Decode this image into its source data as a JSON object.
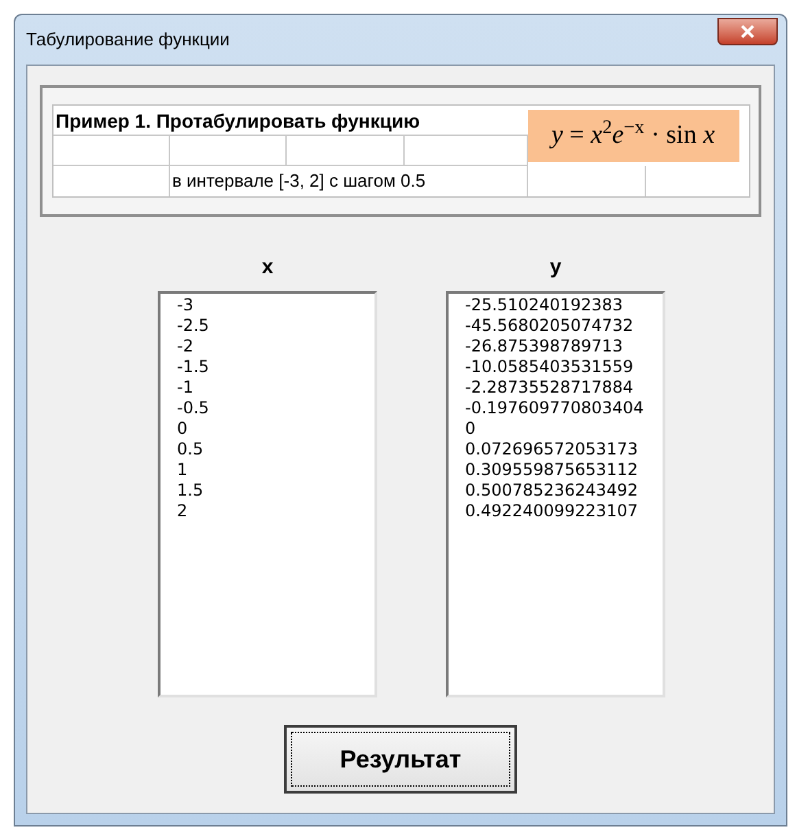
{
  "window": {
    "title": "Табулирование функции"
  },
  "example": {
    "heading": "Пример 1. Протабулировать функцию",
    "formula": "*y* = *x*$^{2}$*e*$^{−x}$ · sin *x*",
    "interval": "в интервале [-3, 2] с шагом 0.5"
  },
  "lists": [
    {
      "header": "x",
      "values": [
        "-3",
        "-2.5",
        "-2",
        "-1.5",
        "-1",
        "-0.5",
        "0",
        "0.5",
        "1",
        "1.5",
        "2"
      ]
    },
    {
      "header": "y",
      "values": [
        "-25.510240192383",
        "-45.5680205074732",
        "-26.875398789713",
        "-10.0585403531559",
        "-2.28735528717884",
        "-0.197609770803404",
        "0",
        "0.072696572053173",
        "0.309559875653112",
        "0.500785236243492",
        "0.492240099223107"
      ]
    }
  ],
  "button": {
    "label": "Результат"
  }
}
